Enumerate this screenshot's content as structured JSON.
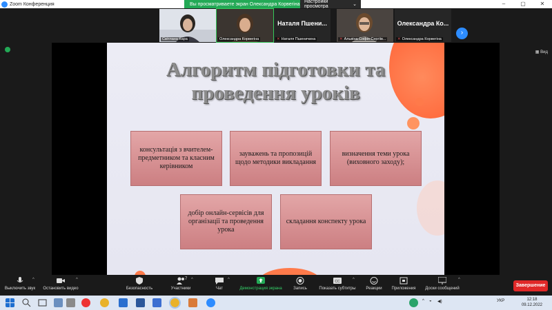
{
  "window": {
    "app_title": "Zoom Конференция",
    "view_banner": "Вы просматриваете экран Олександра Корвегіна",
    "view_options": "Настройки просмотра"
  },
  "participants": [
    {
      "name": "Світлана Кара",
      "display": "video"
    },
    {
      "name": "Олександра Корвегіна",
      "display": "video"
    },
    {
      "name": "Наталя Пшеничина",
      "big_label": "Наталя Пшени...",
      "display": "name"
    },
    {
      "name": "Альвіна Софія Сергіів...",
      "display": "video"
    },
    {
      "name": "Олександра Корвегіна",
      "big_label": "Олександра Ко...",
      "display": "name"
    }
  ],
  "view_button": "Вид",
  "slide": {
    "title_line1": "Алгоритм підготовки та",
    "title_line2": "проведення уроків",
    "boxes": [
      "консультація з вчителем-предметником та класним керівником",
      "зауважень та пропозицій щодо методики викладання",
      "визначення теми урока (виховного заходу);",
      "добір онлайн-сервісів для організації та проведення урока",
      "складання конспекту урока"
    ]
  },
  "toolbar": {
    "mute": "Выключить звук",
    "video": "Остановить видео",
    "security": "Безопасность",
    "participants": "Участники",
    "participants_count": "7",
    "chat": "Чат",
    "share": "Демонстрация экрана",
    "record": "Запись",
    "captions": "Показать субтитры",
    "reactions": "Реакции",
    "apps": "Приложения",
    "whiteboard": "Доски сообщений",
    "end": "Завершение"
  },
  "taskbar": {
    "lang": "УКР",
    "time": "12:18",
    "date": "09.12.2022"
  },
  "colors": {
    "accent": "#2d8cff",
    "share_green": "#23a956",
    "end_red": "#e02828",
    "slide_box": "#d9898b"
  }
}
